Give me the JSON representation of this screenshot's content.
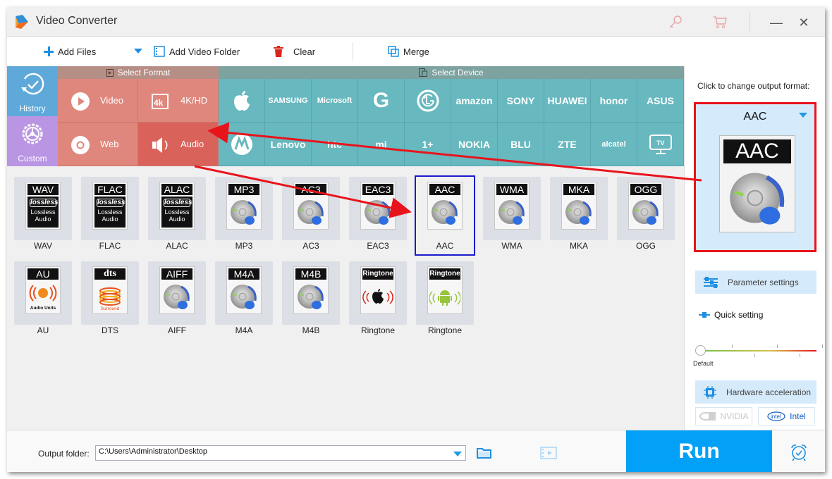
{
  "app": {
    "title": "Video Converter"
  },
  "titlebar": {
    "key_icon": "key-icon",
    "cart_icon": "cart-icon",
    "minimize": "—",
    "close": "✕"
  },
  "toolbar": {
    "add_files": "Add Files",
    "add_video_folder": "Add Video Folder",
    "clear": "Clear",
    "merge": "Merge"
  },
  "left_nav": {
    "history": "History",
    "custom": "Custom"
  },
  "select_format": {
    "header": "Select Format",
    "items": [
      {
        "label": "Video",
        "icon": "play-icon"
      },
      {
        "label": "4K/HD",
        "icon": "4k-icon"
      },
      {
        "label": "Web",
        "icon": "chrome-icon"
      },
      {
        "label": "Audio",
        "icon": "speaker-icon",
        "active": true
      }
    ]
  },
  "select_device": {
    "header": "Select Device",
    "row1": [
      "Apple",
      "SAMSUNG",
      "Microsoft",
      "G",
      "LG",
      "amazon",
      "SONY",
      "HUAWEI",
      "honor",
      "ASUS"
    ],
    "row2": [
      "Motorola",
      "Lenovo",
      "htc",
      "mi",
      "1+",
      "NOKIA",
      "BLU",
      "ZTE",
      "alcatel",
      "TV"
    ]
  },
  "formats": [
    {
      "tag": "WAV",
      "name": "WAV",
      "art": "lossless"
    },
    {
      "tag": "FLAC",
      "name": "FLAC",
      "art": "lossless"
    },
    {
      "tag": "ALAC",
      "name": "ALAC",
      "art": "lossless"
    },
    {
      "tag": "MP3",
      "name": "MP3",
      "art": "disc"
    },
    {
      "tag": "AC3",
      "name": "AC3",
      "art": "disc"
    },
    {
      "tag": "EAC3",
      "name": "EAC3",
      "art": "disc"
    },
    {
      "tag": "AAC",
      "name": "AAC",
      "art": "disc",
      "selected": true
    },
    {
      "tag": "WMA",
      "name": "WMA",
      "art": "disc"
    },
    {
      "tag": "MKA",
      "name": "MKA",
      "art": "disc"
    },
    {
      "tag": "OGG",
      "name": "OGG",
      "art": "disc"
    },
    {
      "tag": "AU",
      "name": "AU",
      "art": "audio-units"
    },
    {
      "tag": "dts",
      "name": "DTS",
      "art": "surround"
    },
    {
      "tag": "AIFF",
      "name": "AIFF",
      "art": "disc"
    },
    {
      "tag": "M4A",
      "name": "M4A",
      "art": "disc"
    },
    {
      "tag": "M4B",
      "name": "M4B",
      "art": "disc"
    },
    {
      "tag": "Ringtone",
      "name": "Ringtone",
      "art": "apple-ringtone"
    },
    {
      "tag": "Ringtone",
      "name": "Ringtone",
      "art": "android-ringtone"
    }
  ],
  "lossless_art": {
    "badge": "lossless",
    "line1": "Lossless",
    "line2": "Audio"
  },
  "au_art": {
    "caption": "Audio Units"
  },
  "dts_art": {
    "caption": "Surround"
  },
  "right_panel": {
    "hint": "Click to change output format:",
    "output_format": "AAC",
    "parameter_settings": "Parameter settings",
    "quick_setting": "Quick setting",
    "slider_label": "Default",
    "slider_value": 0,
    "hardware_acceleration": "Hardware acceleration",
    "nvidia": "NVIDIA",
    "intel": "Intel"
  },
  "bottom": {
    "output_folder_label": "Output folder:",
    "output_folder_value": "C:\\Users\\Administrator\\Desktop",
    "run": "Run"
  },
  "colors": {
    "format_panel": "#e0877d",
    "format_active": "#d9625a",
    "device_panel": "#67b8bf",
    "history": "#5ea9d9",
    "custom": "#b995e3",
    "run": "#03a0f7",
    "highlight_red": "#e8141c",
    "selection_blue": "#1a1acf"
  }
}
